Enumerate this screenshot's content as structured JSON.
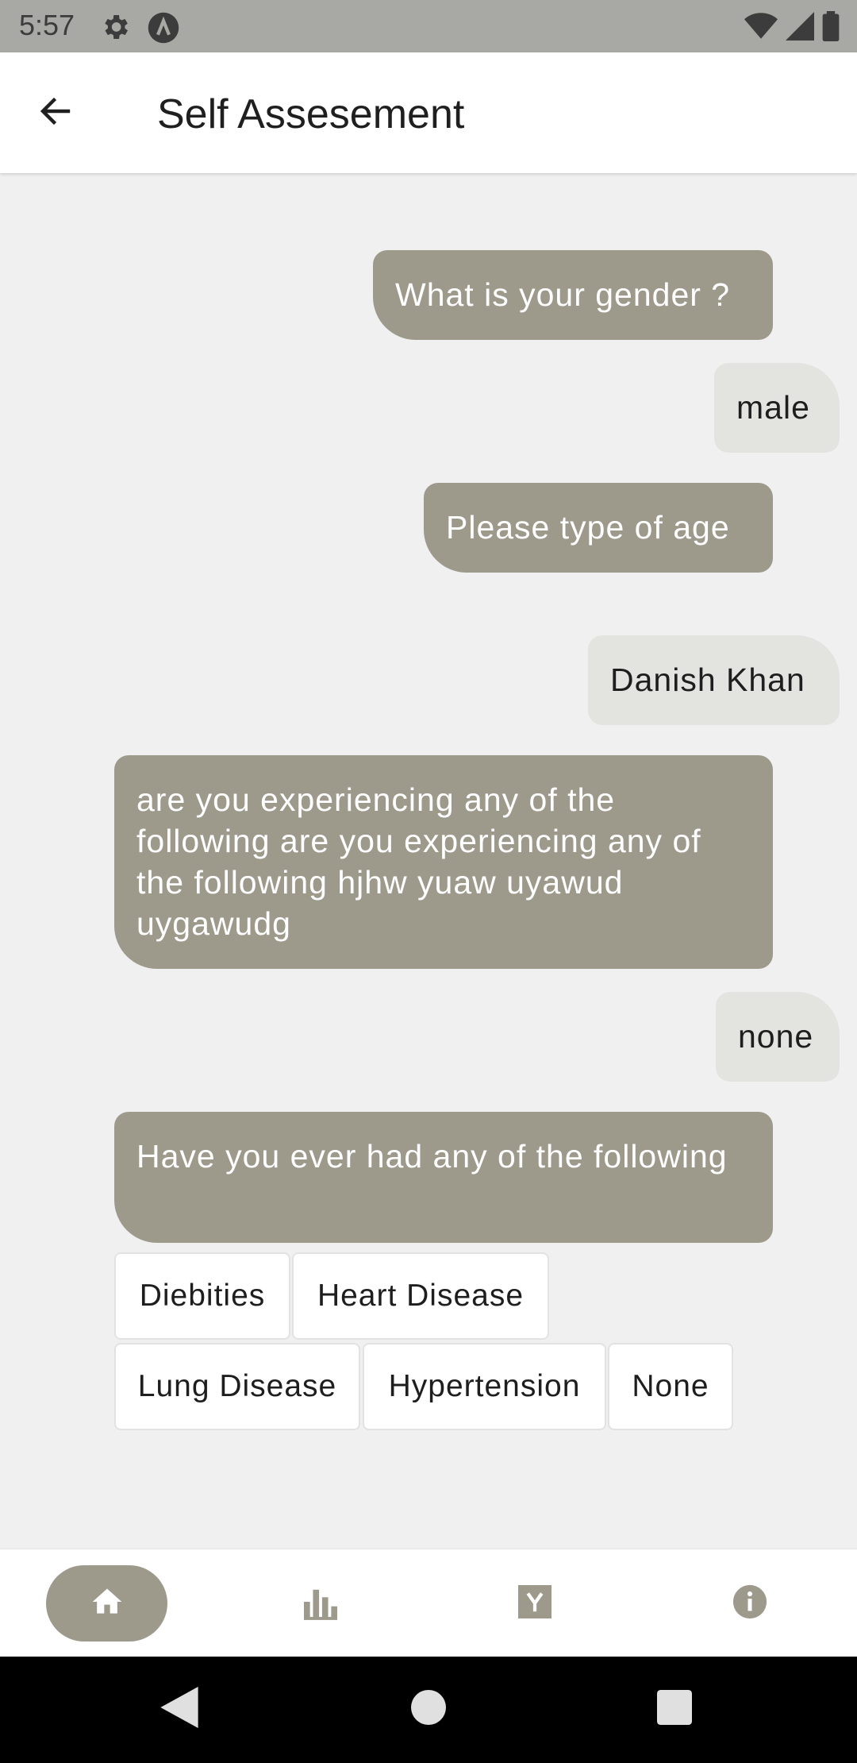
{
  "status_bar": {
    "time": "5:57",
    "icons": [
      "gear-icon",
      "a-badge-icon",
      "wifi-icon",
      "cellular-icon",
      "battery-icon"
    ]
  },
  "header": {
    "title": "Self Assesement",
    "back_icon": "arrow-left-icon"
  },
  "chat": {
    "messages": [
      {
        "sender": "bot",
        "text": "What is your gender ?"
      },
      {
        "sender": "user",
        "text": "male"
      },
      {
        "sender": "bot",
        "text": "Please type of age"
      },
      {
        "sender": "user",
        "text": "Danish Khan"
      },
      {
        "sender": "bot",
        "text": "are you experiencing any of the following are you experiencing any of the following hjhw yuaw uyawud uygawudg"
      },
      {
        "sender": "user",
        "text": "none"
      },
      {
        "sender": "bot",
        "text": "Have you ever had any of the following"
      }
    ],
    "options": [
      "Diebities",
      "Heart Disease",
      "Lung Disease",
      "Hypertension",
      "None"
    ]
  },
  "bottom_nav": {
    "items": [
      {
        "icon": "home-icon",
        "active": true
      },
      {
        "icon": "bar-chart-icon",
        "active": false
      },
      {
        "icon": "y-news-icon",
        "active": false
      },
      {
        "icon": "info-icon",
        "active": false
      }
    ]
  },
  "system_nav": [
    "back-triangle-icon",
    "home-circle-icon",
    "recents-square-icon"
  ],
  "colors": {
    "bot_bubble": "#9d9a8c",
    "user_bubble": "#e3e3e0",
    "background": "#f0f0f0",
    "status_bar": "#a8a8a4",
    "accent": "#9d9a8c"
  }
}
